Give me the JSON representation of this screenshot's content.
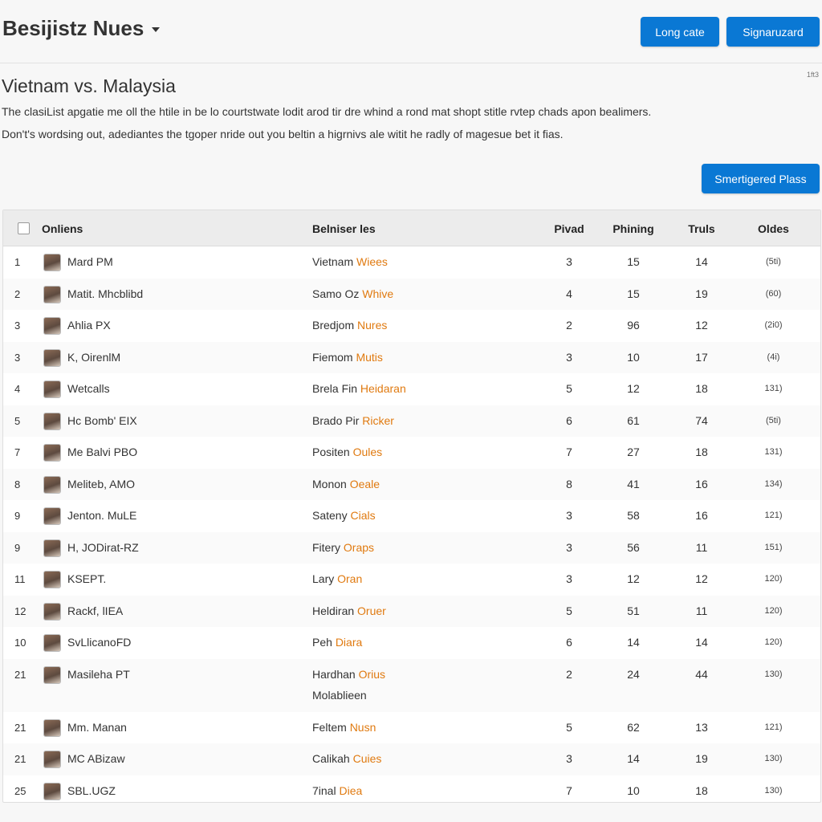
{
  "header": {
    "app_title": "Besijistz Nues",
    "login_label": "Long cate",
    "signup_label": "Signaruzard"
  },
  "corner_tag": "1ft3",
  "page": {
    "heading": "Vietnam vs. Malaysia",
    "description_1": "The clasiList apgatie me oll the htile in be lo courtstwate lodit arod tir dre whind a rond mat shopt stitle rvtep chads apon bealimers.",
    "description_2": "Don't's wordsing out, adediantes the tgoper nride out you beltin a higrnivs ale witit he radly of magesue bet it fias.",
    "action_label": "Smertigered Plass"
  },
  "table": {
    "columns": [
      "Onliens",
      "Belniser les",
      "Pivad",
      "Phining",
      "Truls",
      "Oldes"
    ],
    "rows": [
      {
        "rank": "1",
        "name": "Mard PM",
        "team": "Vietnam",
        "team_hl": "Wiees",
        "team_line2": "",
        "c1": "3",
        "c2": "15",
        "c3": "14",
        "c4": "(5ti)"
      },
      {
        "rank": "2",
        "name": "Matit. Mhcblibd",
        "team": "Samo Oz",
        "team_hl": "Whive",
        "team_line2": "",
        "c1": "4",
        "c2": "15",
        "c3": "19",
        "c4": "(60)"
      },
      {
        "rank": "3",
        "name": "Ahlia PX",
        "team": "Bredjom",
        "team_hl": "Nures",
        "team_line2": "",
        "c1": "2",
        "c2": "96",
        "c3": "12",
        "c4": "(2i0)"
      },
      {
        "rank": "3",
        "name": "K, OirenlM",
        "team": "Fiemom",
        "team_hl": "Mutis",
        "team_line2": "",
        "c1": "3",
        "c2": "10",
        "c3": "17",
        "c4": "(4i)"
      },
      {
        "rank": "4",
        "name": "Wetcalls",
        "team": "Brela Fin",
        "team_hl": "Heidaran",
        "team_line2": "",
        "c1": "5",
        "c2": "12",
        "c3": "18",
        "c4": "131)"
      },
      {
        "rank": "5",
        "name": "Hc Bomb' EIX",
        "team": "Brado Pir",
        "team_hl": "Ricker",
        "team_line2": "",
        "c1": "6",
        "c2": "61",
        "c3": "74",
        "c4": "(5ti)"
      },
      {
        "rank": "7",
        "name": "Me Balvi PBO",
        "team": "Positen",
        "team_hl": "Oules",
        "team_line2": "",
        "c1": "7",
        "c2": "27",
        "c3": "18",
        "c4": "131)"
      },
      {
        "rank": "8",
        "name": "Meliteb, AMO",
        "team": "Monon",
        "team_hl": "Oeale",
        "team_line2": "",
        "c1": "8",
        "c2": "41",
        "c3": "16",
        "c4": "134)"
      },
      {
        "rank": "9",
        "name": "Jenton. MuLE",
        "team": "Sateny",
        "team_hl": "Cials",
        "team_line2": "",
        "c1": "3",
        "c2": "58",
        "c3": "16",
        "c4": "121)"
      },
      {
        "rank": "9",
        "name": "H, JODirat-RZ",
        "team": "Fitery",
        "team_hl": "Oraps",
        "team_line2": "",
        "c1": "3",
        "c2": "56",
        "c3": "11",
        "c4": "151)"
      },
      {
        "rank": "11",
        "name": "KSEPT.",
        "team": "Lary",
        "team_hl": "Oran",
        "team_line2": "",
        "c1": "3",
        "c2": "12",
        "c3": "12",
        "c4": "120)"
      },
      {
        "rank": "12",
        "name": "Rackf, lIEA",
        "team": "Heldiran",
        "team_hl": "Oruer",
        "team_line2": "",
        "c1": "5",
        "c2": "51",
        "c3": "11",
        "c4": "120)"
      },
      {
        "rank": "10",
        "name": "SvLlicanoFD",
        "team": "Peh",
        "team_hl": "Diara",
        "team_line2": "",
        "c1": "6",
        "c2": "14",
        "c3": "14",
        "c4": "120)"
      },
      {
        "rank": "21",
        "name": "Masileha PT",
        "team": "Hardhan",
        "team_hl": "Orius",
        "team_line2": "Molablieen",
        "c1": "2",
        "c2": "24",
        "c3": "44",
        "c4": "130)"
      },
      {
        "rank": "21",
        "name": "Mm. Manan",
        "team": "Feltem",
        "team_hl": "Nusn",
        "team_line2": "",
        "c1": "5",
        "c2": "62",
        "c3": "13",
        "c4": "121)"
      },
      {
        "rank": "21",
        "name": "MC ABizaw",
        "team": "Calikah",
        "team_hl": "Cuies",
        "team_line2": "",
        "c1": "3",
        "c2": "14",
        "c3": "19",
        "c4": "130)"
      },
      {
        "rank": "25",
        "name": "SBL.UGZ",
        "team": "7inal",
        "team_hl": "Diea",
        "team_line2": "",
        "c1": "7",
        "c2": "10",
        "c3": "18",
        "c4": "130)"
      }
    ]
  },
  "colors": {
    "accent": "#0a78d4",
    "highlight": "#e07a10"
  }
}
